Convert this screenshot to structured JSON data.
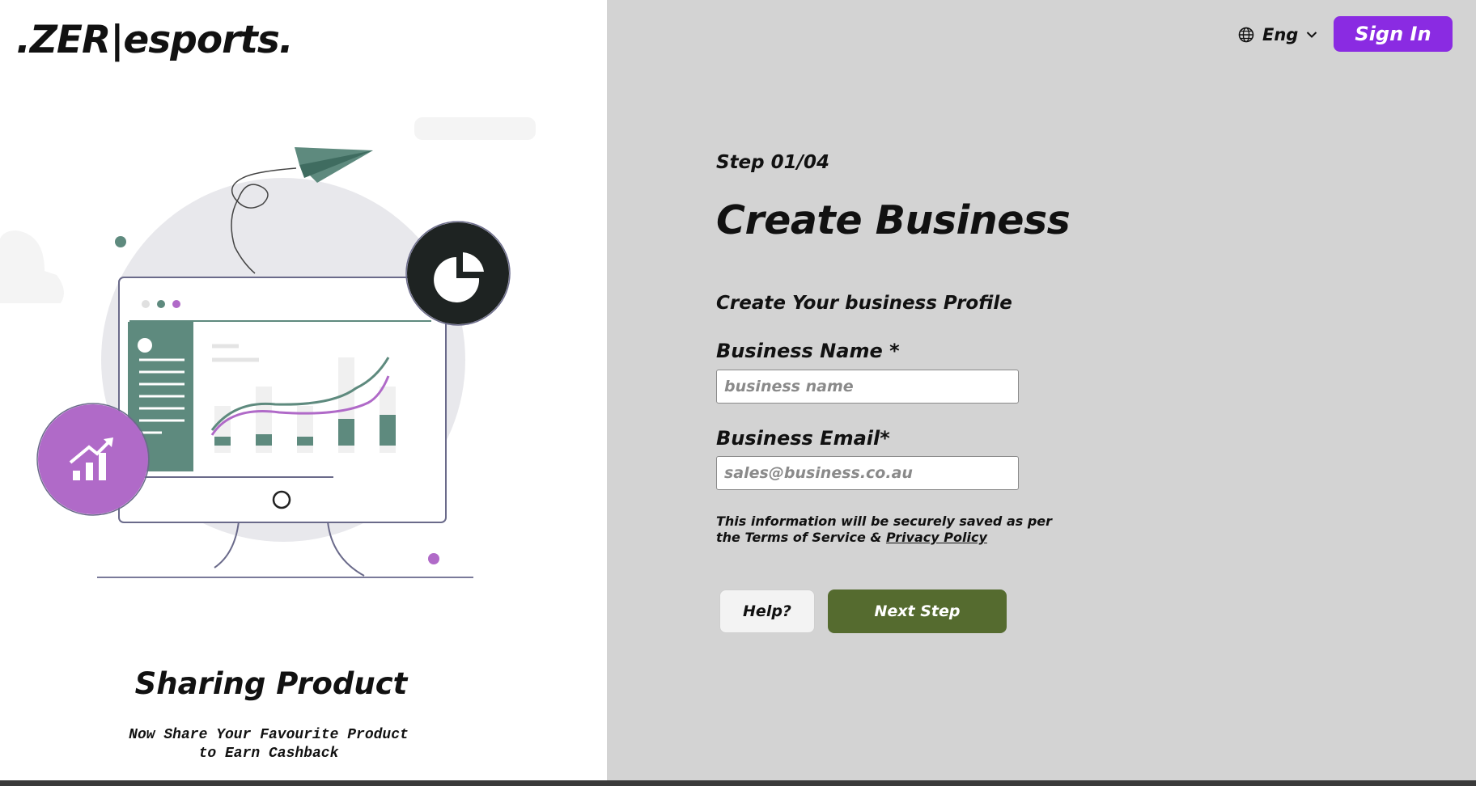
{
  "header": {
    "logo_text": ".ZER|esports.",
    "language_label": "Eng",
    "signin_label": "Sign In"
  },
  "promo": {
    "title": "Sharing Product",
    "subtitle": "Now Share Your Favourite Product\nto Earn Cashback"
  },
  "form": {
    "step_label": "Step 01/04",
    "title": "Create Business",
    "subtitle": "Create Your business Profile",
    "business_name_label": "Business Name *",
    "business_name_placeholder": "business name",
    "business_name_value": "",
    "business_email_label": "Business Email*",
    "business_email_placeholder": "sales@business.co.au",
    "business_email_value": "",
    "disclaimer_text": "This information will be securely saved as per the Terms of Service & ",
    "privacy_link_label": "Privacy Policy",
    "help_label": "Help?",
    "next_label": "Next Step"
  },
  "icons": {
    "language": "globe-icon",
    "dropdown": "chevron-down-icon",
    "pie_badge": "pie-chart-icon",
    "growth_badge": "growth-chart-icon",
    "plane": "paper-plane-icon"
  },
  "colors": {
    "left_background": "#ffffff",
    "right_background": "#d3d3d3",
    "signin_button": "#8a2be2",
    "next_button": "#556b2f",
    "help_button": "#f3f3f3",
    "illustration_green": "#5e8a7e",
    "illustration_purple": "#b06ac8",
    "illustration_dark": "#1e2322"
  }
}
